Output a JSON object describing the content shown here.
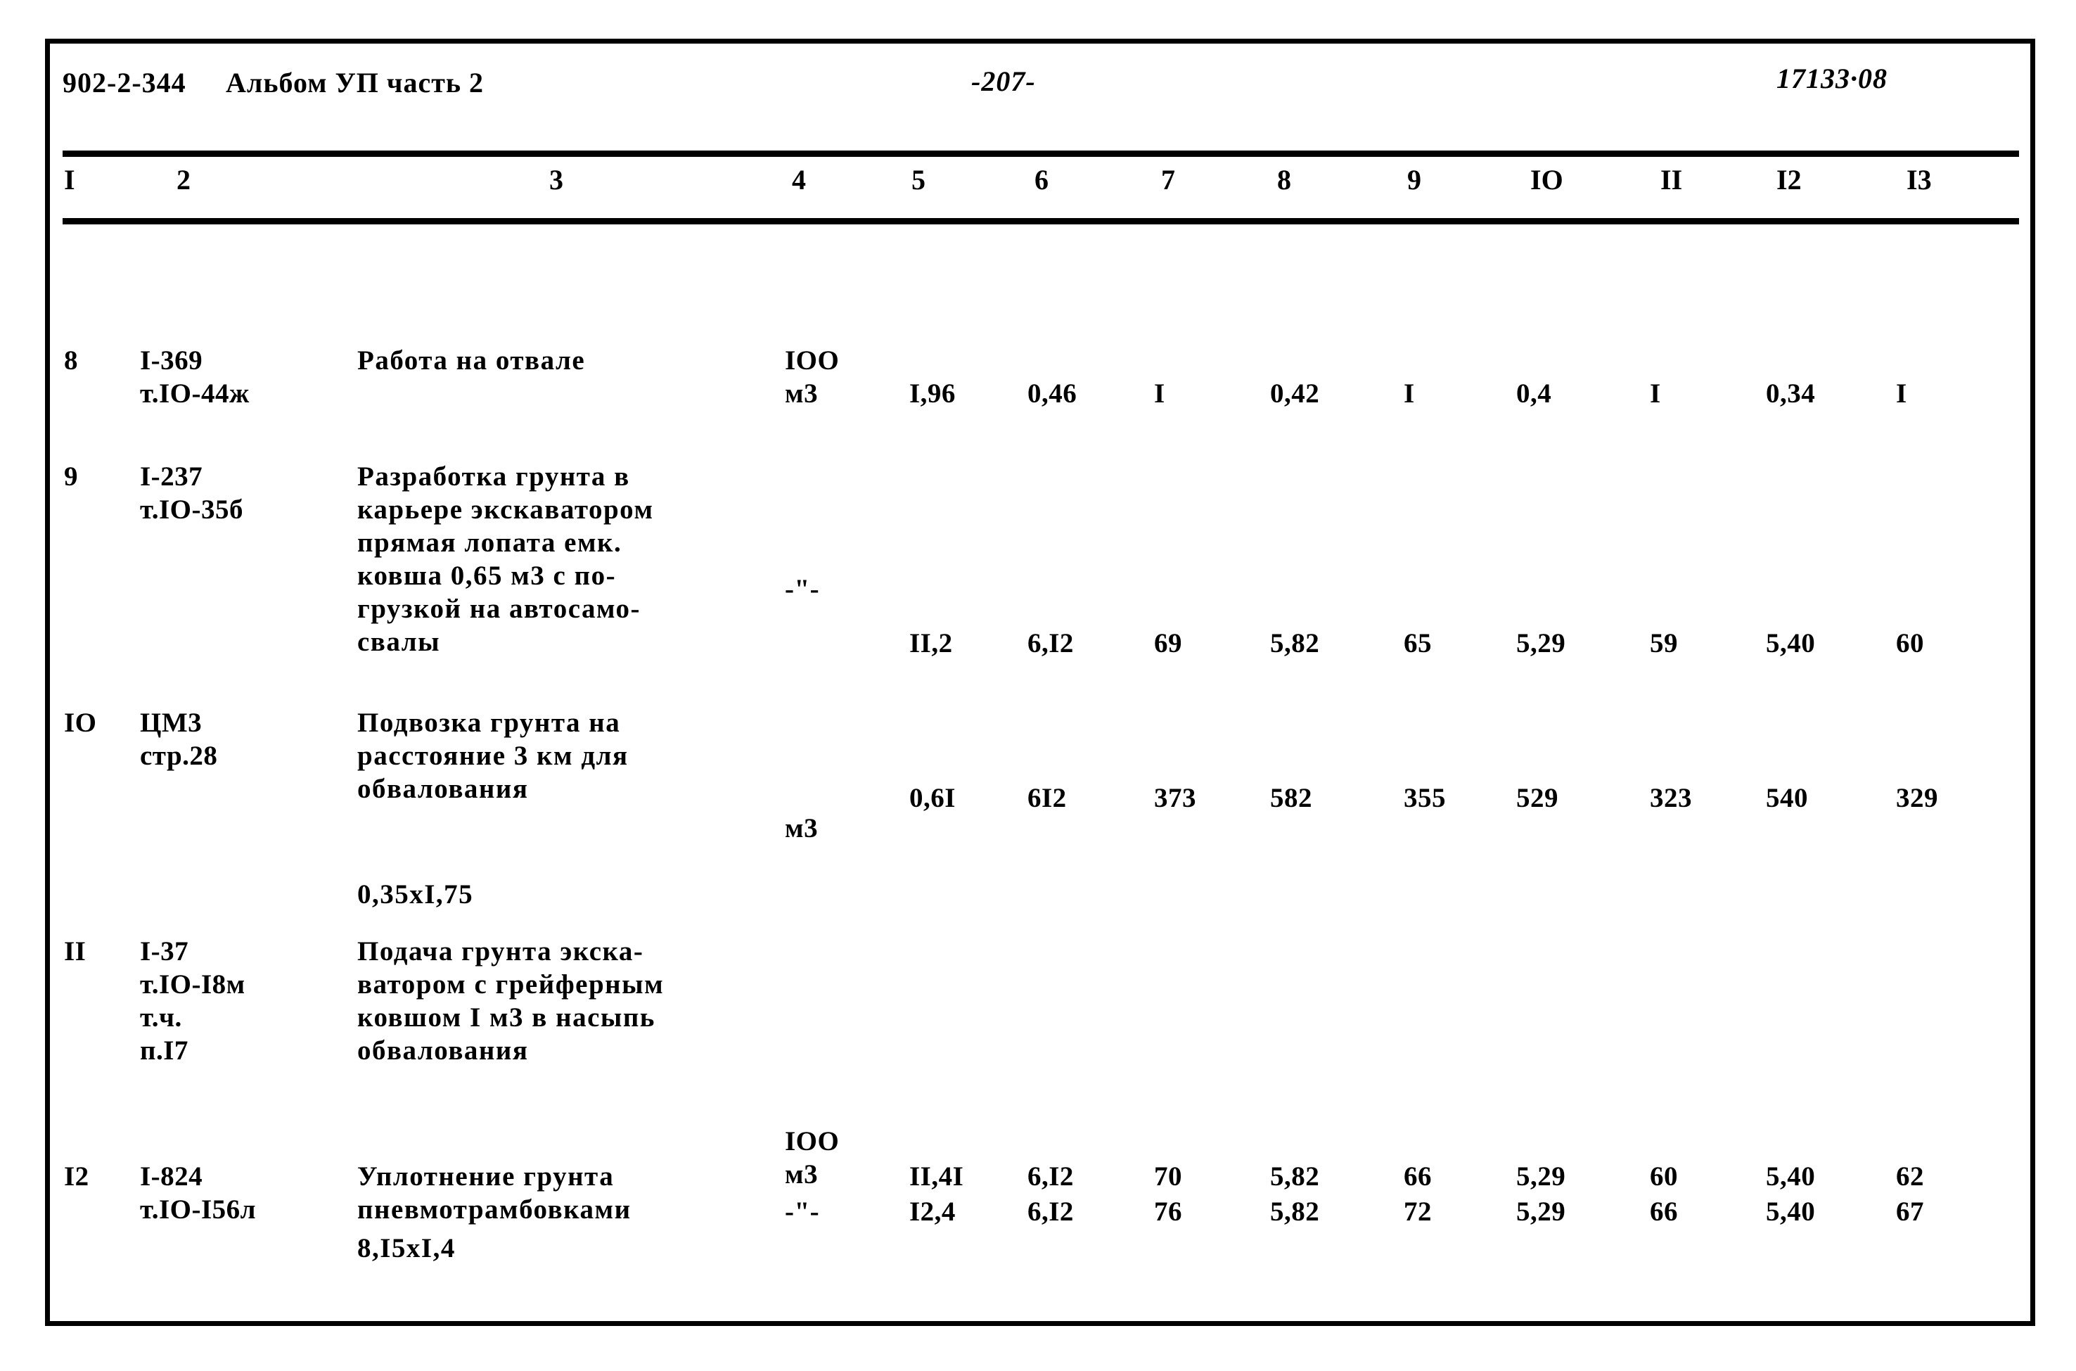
{
  "header": {
    "project_code": "902-2-344",
    "album": "Альбом УП часть 2",
    "page_number": "-207-",
    "doc_code": "17133·08"
  },
  "table": {
    "column_headers": [
      "I",
      "2",
      "3",
      "4",
      "5",
      "6",
      "7",
      "8",
      "9",
      "IO",
      "II",
      "I2",
      "I3"
    ],
    "rows": [
      {
        "num": "8",
        "code_lines": [
          "I-369",
          "т.IO-44ж"
        ],
        "description_lines": [
          "Работа на отвале"
        ],
        "description_extra": "",
        "unit_lines": [
          "IOO",
          "м3"
        ],
        "values": [
          "I,96",
          "0,46",
          "I",
          "0,42",
          "I",
          "0,4",
          "I",
          "0,34",
          "I"
        ]
      },
      {
        "num": "9",
        "code_lines": [
          "I-237",
          "т.IO-35б"
        ],
        "description_lines": [
          "Разработка грунта в",
          "карьере экскаватором",
          "прямая лопата емк.",
          "ковша 0,65 м3 с по-",
          "грузкой на автосамо-",
          "свалы"
        ],
        "description_extra": "",
        "unit_lines": [
          "-\"-"
        ],
        "values": [
          "II,2",
          "6,I2",
          "69",
          "5,82",
          "65",
          "5,29",
          "59",
          "5,40",
          "60"
        ]
      },
      {
        "num": "IO",
        "code_lines": [
          "ЦМ3",
          "стр.28"
        ],
        "description_lines": [
          "Подвозка грунта на",
          "расстояние 3 км для",
          "обвалования"
        ],
        "description_extra": "0,35хI,75",
        "unit_lines": [
          "м3"
        ],
        "values": [
          "0,6I",
          "6I2",
          "373",
          "582",
          "355",
          "529",
          "323",
          "540",
          "329"
        ]
      },
      {
        "num": "II",
        "code_lines": [
          "I-37",
          "т.IO-I8м",
          "т.ч.",
          "п.I7"
        ],
        "description_lines": [
          "Подача грунта экска-",
          "ватором с грейферным",
          "ковшом I м3 в насыпь",
          "обвалования"
        ],
        "description_extra": "8,I5хI,4",
        "unit_lines": [
          "IOO",
          "м3"
        ],
        "values": [
          "II,4I",
          "6,I2",
          "70",
          "5,82",
          "66",
          "5,29",
          "60",
          "5,40",
          "62"
        ]
      },
      {
        "num": "I2",
        "code_lines": [
          "I-824",
          "т.IO-I56л"
        ],
        "description_lines": [
          "Уплотнение грунта",
          "пневмотрамбовками"
        ],
        "description_extra": "",
        "unit_lines": [
          "-\"-"
        ],
        "values": [
          "I2,4",
          "6,I2",
          "76",
          "5,82",
          "72",
          "5,29",
          "66",
          "5,40",
          "67"
        ]
      }
    ]
  },
  "layout": {
    "col_x": [
      20,
      128,
      437,
      1045,
      1222,
      1390,
      1570,
      1735,
      1925,
      2085,
      2275,
      2440,
      2625
    ],
    "col_header_x": [
      20,
      180,
      710,
      1055,
      1225,
      1400,
      1580,
      1745,
      1930,
      2105,
      2290,
      2455,
      2640
    ],
    "row_tops": [
      170,
      335,
      685,
      1010,
      1330
    ],
    "unit_tops": [
      0,
      160,
      150,
      270,
      50
    ],
    "value_tops": [
      47,
      237,
      107,
      320,
      50
    ],
    "extra_tops": [
      0,
      0,
      244,
      422,
      0
    ]
  }
}
